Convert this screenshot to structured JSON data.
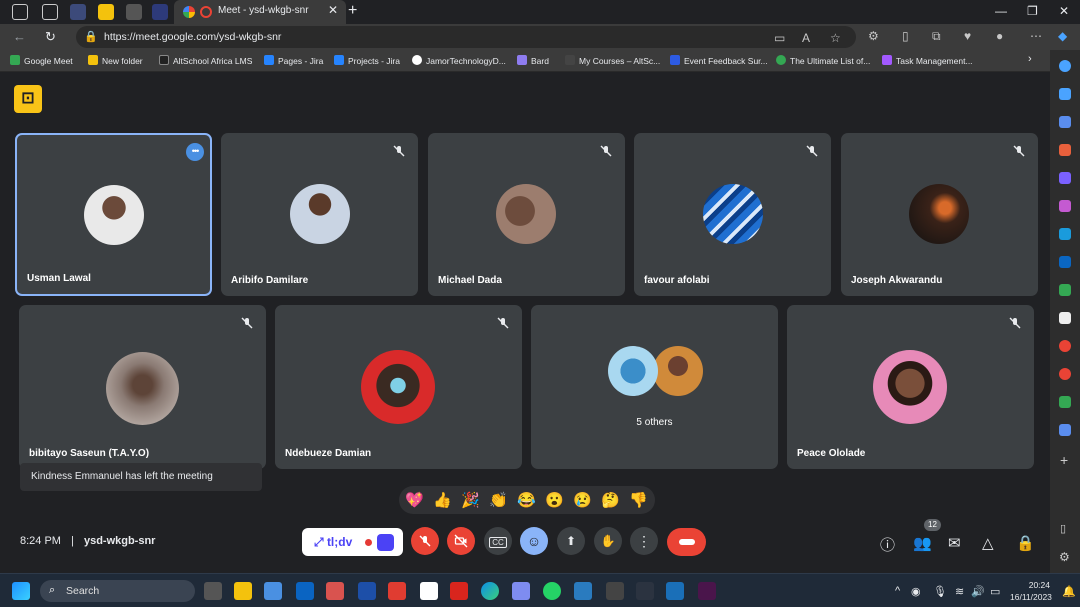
{
  "browser": {
    "active_tab_title": "Meet - ysd-wkgb-snr",
    "url": "https://meet.google.com/ysd-wkgb-snr",
    "bookmarks": [
      "Google Meet",
      "New folder",
      "AltSchool Africa LMS",
      "Pages - Jira",
      "Projects - Jira",
      "JamorTechnologyD...",
      "Bard",
      "My Courses – AltSc...",
      "Event Feedback Sur...",
      "The Ultimate List of...",
      "Task Management..."
    ]
  },
  "meet": {
    "participants": [
      {
        "name": "Usman Lawal",
        "active": true
      },
      {
        "name": "Aribifo Damilare"
      },
      {
        "name": "Michael Dada"
      },
      {
        "name": "favour afolabi"
      },
      {
        "name": "Joseph Akwarandu"
      },
      {
        "name": "bibitayo Saseun (T.A.Y.O)"
      },
      {
        "name": "Ndebueze Damian"
      },
      {
        "name": "Peace Ololade"
      }
    ],
    "others_label": "5 others",
    "toast": "Kindness Emmanuel has left the meeting",
    "reactions": [
      "💖",
      "👍",
      "🎉",
      "👏",
      "😂",
      "😮",
      "😢",
      "🤔",
      "👎"
    ],
    "time": "8:24 PM",
    "separator": "|",
    "meeting_code": "ysd-wkgb-snr",
    "tldv_label": "tl;dv",
    "people_count": "12"
  },
  "taskbar": {
    "search_label": "Search",
    "clock_time": "20:24",
    "clock_date": "16/11/2023"
  },
  "colors": {
    "meet_bg": "#202124",
    "tile_bg": "#3c4043",
    "end_call_red": "#ea4335",
    "accent_blue": "#8ab4f8"
  }
}
